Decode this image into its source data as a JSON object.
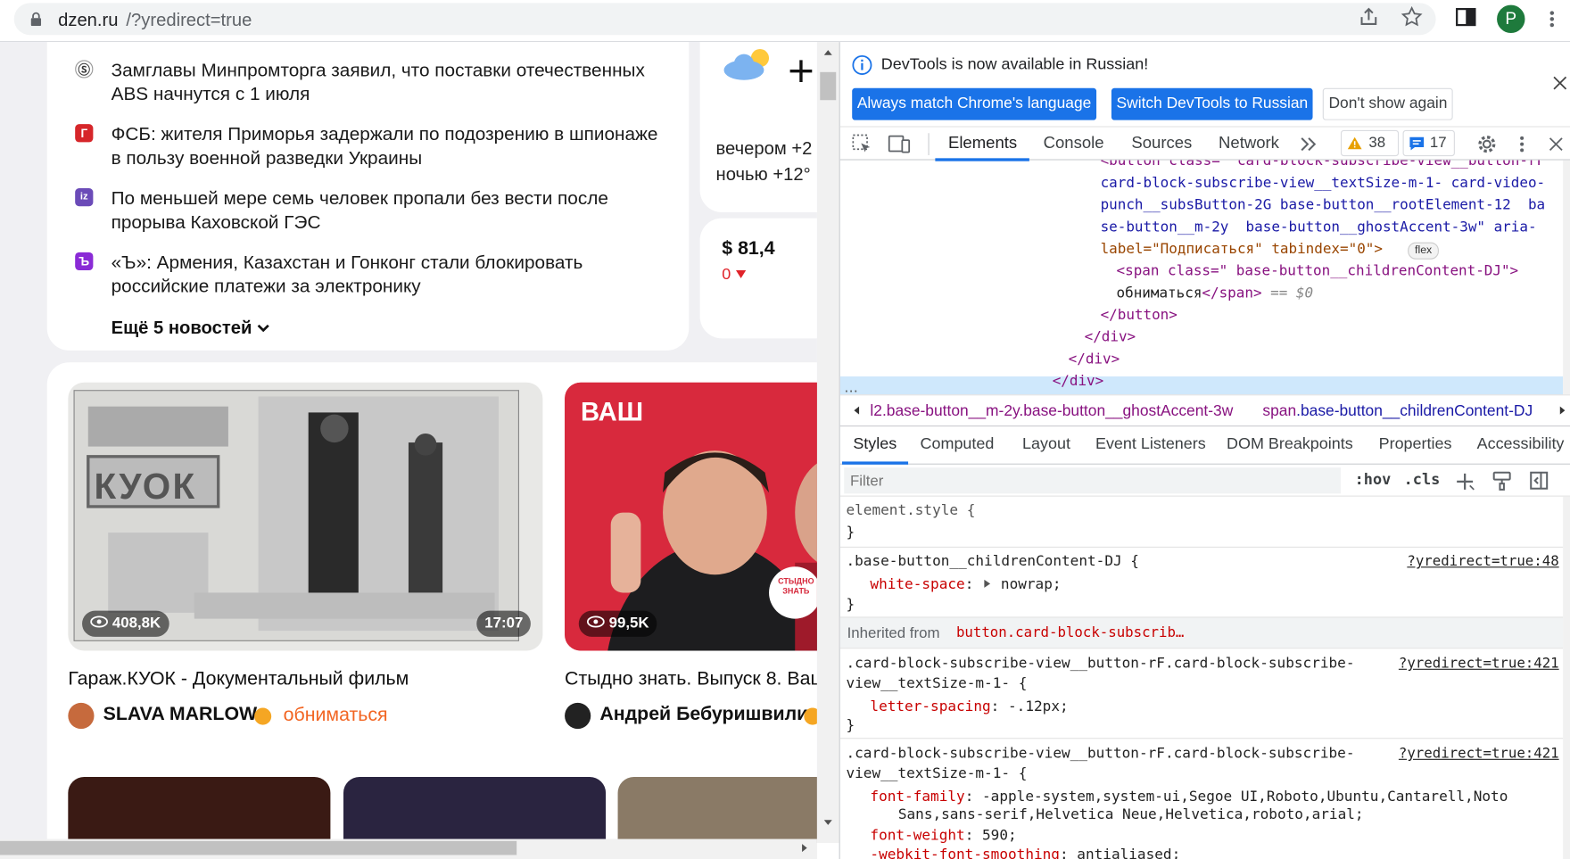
{
  "browser": {
    "url_host": "dzen.ru",
    "url_path": "/?yredirect=true",
    "profile_initial": "P"
  },
  "news": {
    "items": [
      {
        "text": "Замглавы Минпромторга заявил, что поставки отечественных ABS начнутся с 1 июля",
        "icon_label": "Ⓢ",
        "icon_color": "#ffffff"
      },
      {
        "text": "ФСБ: жителя Приморья задержали по подозрению в шпионаже в пользу военной разведки Украины",
        "icon_label": "Г",
        "icon_color": "#d6262a"
      },
      {
        "text": "По меньшей мере семь человек пропали без вести после прорыва Каховской ГЭС",
        "icon_label": "iz",
        "icon_color": "#6b4bb8"
      },
      {
        "text": "«Ъ»: Армения, Казахстан и Гонконг стали блокировать российские платежи за электронику",
        "icon_label": "Ъ",
        "icon_color": "#8a2bd6"
      }
    ],
    "more_label": "Ещё 5 новостей"
  },
  "weather": {
    "evening": "вечером +2",
    "night": "ночью +12°"
  },
  "rate": {
    "value": "$ 81,4",
    "change": "0"
  },
  "videos": [
    {
      "views": "408,8K",
      "duration": "17:07",
      "title": "Гараж.КУОК - Документальный фильм",
      "channel": "SLAVA MARLOW",
      "subscribe": "обниматься"
    },
    {
      "views": "99,5K",
      "duration": "",
      "title": "Стыдно знать. Выпуск 8. Ваш",
      "channel": "Андрей Бебуришвили",
      "subscribe": ""
    }
  ],
  "thumb_text": {
    "garage": "КУОК",
    "vash": "ВАШ",
    "stydno": "СТЫДНО ЗНАТЬ"
  },
  "devtools": {
    "infobar": "DevTools is now available in Russian!",
    "btn_match": "Always match Chrome's language",
    "btn_switch": "Switch DevTools to Russian",
    "btn_dont": "Don't show again",
    "tabs": [
      "Elements",
      "Console",
      "Sources",
      "Network"
    ],
    "warnings": "38",
    "messages": "17",
    "dom_lines": [
      "<button class=\" card-block-subscribe-view__button-rF",
      "card-block-subscribe-view__textSize-m-1- card-video-",
      "punch__subsButton-2G base-button__rootElement-12  ba",
      "se-button__m-2y  base-button__ghostAccent-3w\" aria-",
      "label=\"Подписаться\" tabindex=\"0\">"
    ],
    "flex_badge": "flex",
    "sel_line1": "<span class=\" base-button__childrenContent-DJ\">",
    "sel_text": "обниматься",
    "sel_close": "</span>",
    "sel_eq": " == $0",
    "close_button": "</button>",
    "close_div": "</div>",
    "crumb1": "l2.base-button__m-2y.base-button__ghostAccent-3w",
    "crumb2_tag": "span",
    "crumb2_cls": ".base-button__childrenContent-DJ",
    "style_tabs": [
      "Styles",
      "Computed",
      "Layout",
      "Event Listeners",
      "DOM Breakpoints",
      "Properties",
      "Accessibility"
    ],
    "filter_placeholder": "Filter",
    "hov": ":hov",
    "cls": ".cls",
    "element_style": "element.style {",
    "close_brace": "}",
    "rule1_selector": ".base-button__childrenContent-DJ {",
    "rule1_link": "?yredirect=true:48",
    "rule1_prop": "white-space",
    "rule1_val": "nowrap;",
    "inherited_label": "Inherited from",
    "inherited_from": "button.card-block-subscrib…",
    "rule2_sel_a": ".card-block-subscribe-view__button-rF.card-block-subscribe-",
    "rule2_sel_b": "view__textSize-m-1- {",
    "rule2_link": "?yredirect=true:421",
    "rule2_prop": "letter-spacing",
    "rule2_val": "-.12px;",
    "rule3_sel_a": ".card-block-subscribe-view__button-rF.card-block-subscribe-",
    "rule3_sel_b": "view__textSize-m-1- {",
    "rule3_link": "?yredirect=true:421",
    "rule3_prop1": "font-family",
    "rule3_val1a": "-apple-system,system-ui,Segoe UI,Roboto,Ubuntu,Cantarell,Noto",
    "rule3_val1b": "Sans,sans-serif,Helvetica Neue,Helvetica,roboto,arial;",
    "rule3_prop2": "font-weight",
    "rule3_val2": "590;",
    "rule3_prop3": "-webkit-font-smoothing",
    "rule3_val3": "antialiased;"
  }
}
